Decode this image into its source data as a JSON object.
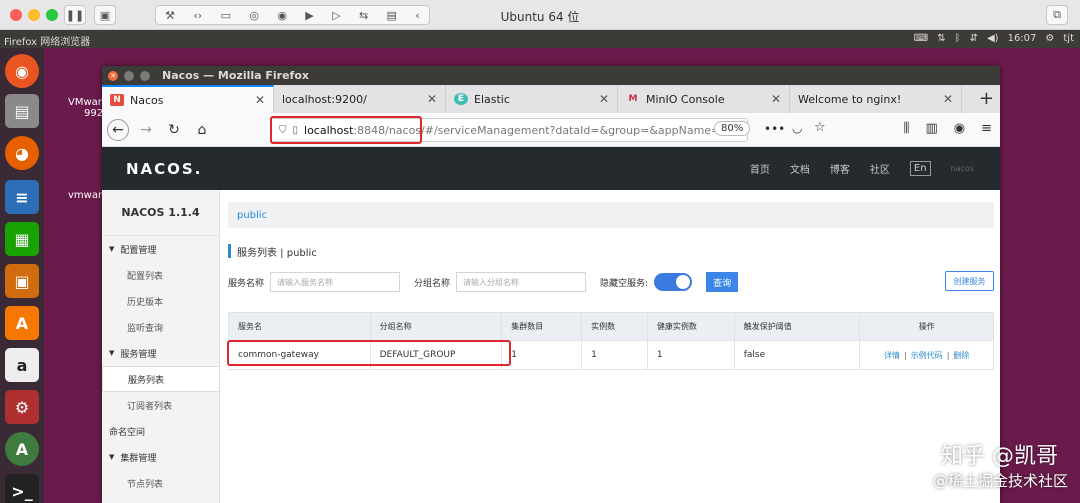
{
  "mac": {
    "vm_title": "Ubuntu 64 位"
  },
  "ubuntu_panel": {
    "app_name": "Firefox 网络浏览器",
    "time": "16:07",
    "user": "tjt"
  },
  "desktop": {
    "label1": "VMwar",
    "label1b": "992",
    "label2": "vmwar"
  },
  "firefox": {
    "window_title": "Nacos — Mozilla Firefox",
    "tabs": [
      {
        "label": "Nacos",
        "fav": "N"
      },
      {
        "label": "localhost:9200/",
        "fav": ""
      },
      {
        "label": "Elastic",
        "fav": "E"
      },
      {
        "label": "MinIO Console",
        "fav": "M"
      },
      {
        "label": "Welcome to nginx!",
        "fav": ""
      }
    ],
    "url_host": "localhost",
    "url_rest": ":8848/nacos/#/serviceManagement?dataId=&group=&appName=&nam",
    "zoom": "80%"
  },
  "nacos": {
    "logo": "NACOS.",
    "menu": [
      "首页",
      "文档",
      "博客",
      "社区",
      "En",
      "nacos"
    ],
    "version": "NACOS 1.1.4",
    "sidebar": {
      "group_config": "配置管理",
      "config_list": "配置列表",
      "history": "历史版本",
      "listen": "监听查询",
      "group_service": "服务管理",
      "service_list": "服务列表",
      "subscriber_list": "订阅者列表",
      "namespace": "命名空间",
      "group_cluster": "集群管理",
      "node_list": "节点列表"
    },
    "breadcrumb": "public",
    "heading": "服务列表 | public",
    "filters": {
      "service_label": "服务名称",
      "service_placeholder": "请输入服务名称",
      "group_label": "分组名称",
      "group_placeholder": "请输入分组名称",
      "hide_empty_label": "隐藏空服务:",
      "query_button": "查询",
      "create_button": "创建服务"
    },
    "table": {
      "headers": [
        "服务名",
        "分组名称",
        "集群数目",
        "实例数",
        "健康实例数",
        "触发保护阈值",
        "操作"
      ],
      "rows": [
        {
          "service": "common-gateway",
          "group": "DEFAULT_GROUP",
          "clusters": "1",
          "instances": "1",
          "healthy": "1",
          "protect": "false",
          "op_detail": "详情",
          "op_sample": "示例代码",
          "op_delete": "删除"
        }
      ]
    }
  },
  "watermark": {
    "zhihu": "知乎 @凯哥",
    "juejin": "@稀土掘金技术社区"
  }
}
